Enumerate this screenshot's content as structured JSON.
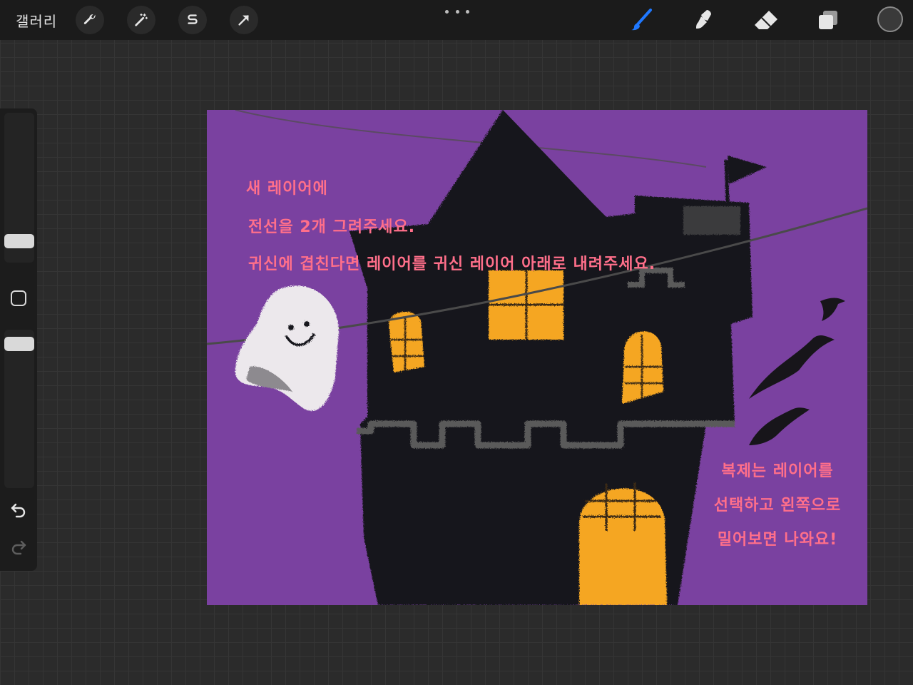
{
  "toolbar": {
    "gallery_label": "갤러리",
    "left_tools": [
      "wrench-icon",
      "magic-wand-icon",
      "s-curve-icon",
      "arrow-icon"
    ],
    "right_tools": [
      "brush-icon",
      "smudge-icon",
      "eraser-icon",
      "layers-icon"
    ],
    "active_tool": "brush-icon",
    "active_color": "#1f78ff",
    "current_color": "#3a3a3a"
  },
  "sidebar": {
    "brush_size_icon": "slider-thumb",
    "opacity_icon": "slider-thumb",
    "modify_icon": "square-icon",
    "undo_icon": "undo-icon",
    "redo_icon": "redo-icon"
  },
  "canvas": {
    "background_color": "#7a41a0",
    "notes_top": [
      "새 레이어에",
      "전선을  2개  그려주세요.",
      "귀신에  겹친다면  레이어를  귀신 레이어 아래로 내려주세요."
    ],
    "notes_right": [
      "복제는 레이어를",
      "선택하고 왼쪽으로",
      "밀어보면 나와요!"
    ],
    "note_color": "#ff6f8a"
  }
}
